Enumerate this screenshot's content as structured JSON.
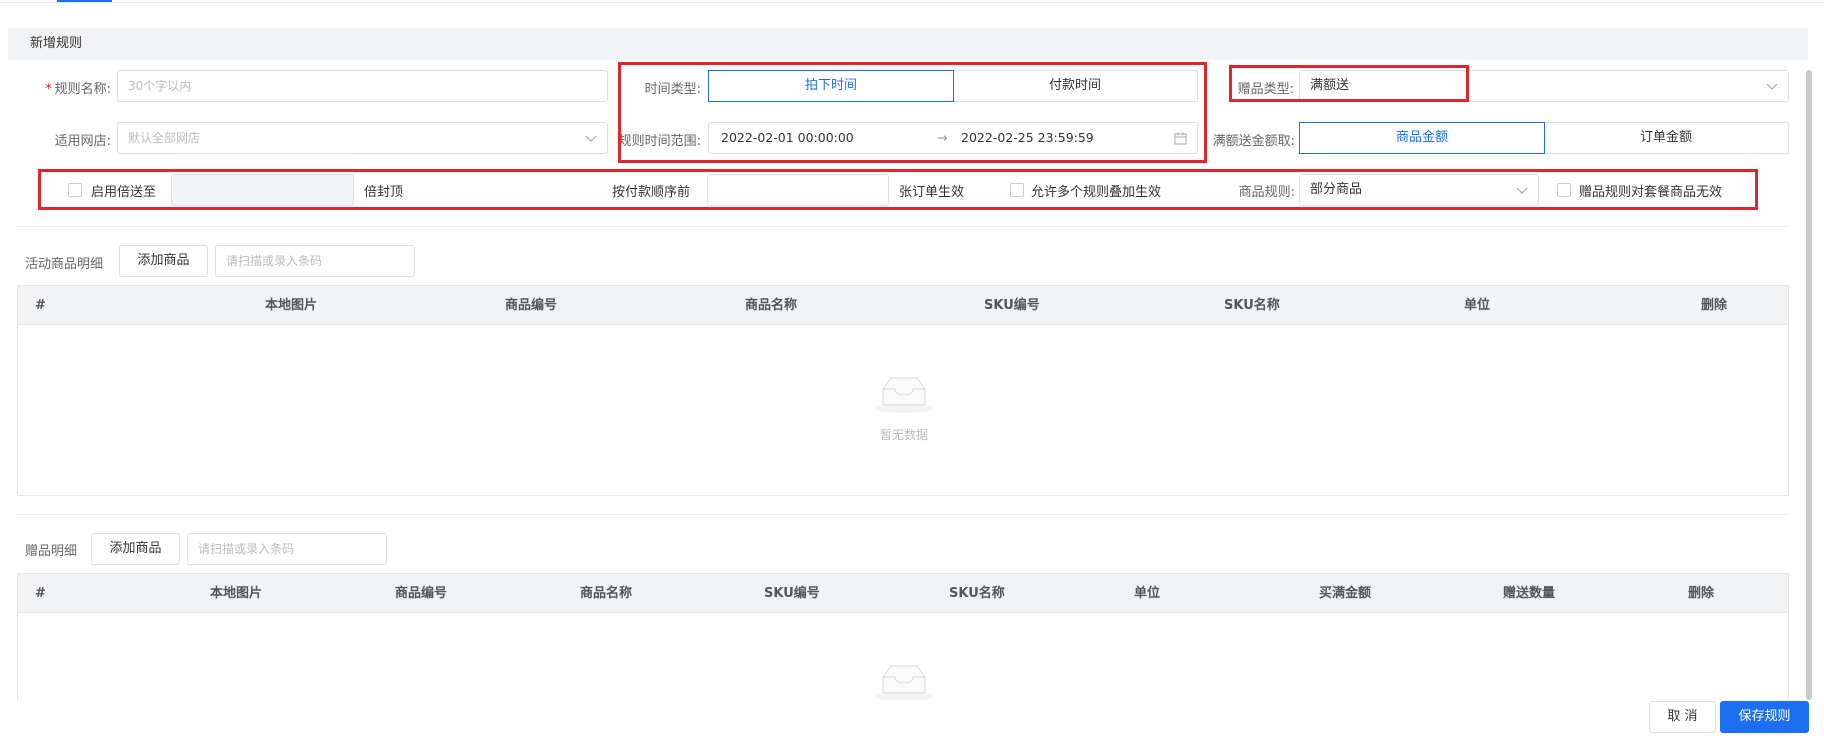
{
  "section_title": "新增规则",
  "form": {
    "rule_name": {
      "label": "规则名称:",
      "required_mark": "*",
      "placeholder": "30个字以内"
    },
    "time_type": {
      "label": "时间类型:",
      "options": [
        "拍下时间",
        "付款时间"
      ],
      "selected": "拍下时间"
    },
    "gift_type": {
      "label": "赠品类型:",
      "value": "满额送"
    },
    "store": {
      "label": "适用网店:",
      "placeholder": "默认全部网店"
    },
    "time_range": {
      "label": "规则时间范围:",
      "start": "2022-02-01 00:00:00",
      "separator": "→",
      "end": "2022-02-25 23:59:59"
    },
    "amount_source": {
      "label": "满额送金额取:",
      "options": [
        "商品金额",
        "订单金额"
      ],
      "selected": "商品金额"
    },
    "multiplier": {
      "checkbox_label": "启用倍送至",
      "suffix": "倍封顶"
    },
    "pay_order": {
      "label": "按付款顺序前",
      "suffix": "张订单生效"
    },
    "allow_stack": {
      "checkbox_label": "允许多个规则叠加生效"
    },
    "product_rule": {
      "label": "商品规则:",
      "value": "部分商品"
    },
    "bundle_invalid": {
      "checkbox_label": "赠品规则对套餐商品无效"
    }
  },
  "activity_products": {
    "title": "活动商品明细",
    "add_button": "添加商品",
    "scan_placeholder": "请扫描或录入条码",
    "columns": [
      "#",
      "本地图片",
      "商品编号",
      "商品名称",
      "SKU编号",
      "SKU名称",
      "单位",
      "删除"
    ],
    "empty_text": "暂无数据"
  },
  "gift_products": {
    "title": "赠品明细",
    "add_button": "添加商品",
    "scan_placeholder": "请扫描或录入条码",
    "columns": [
      "#",
      "本地图片",
      "商品编号",
      "商品名称",
      "SKU编号",
      "SKU名称",
      "单位",
      "买满金额",
      "赠送数量",
      "删除"
    ]
  },
  "footer": {
    "cancel": "取 消",
    "save": "保存规则"
  },
  "colors": {
    "accent": "#1d6ff2",
    "highlight_box": "#e4242b",
    "required": "#f5222d"
  }
}
